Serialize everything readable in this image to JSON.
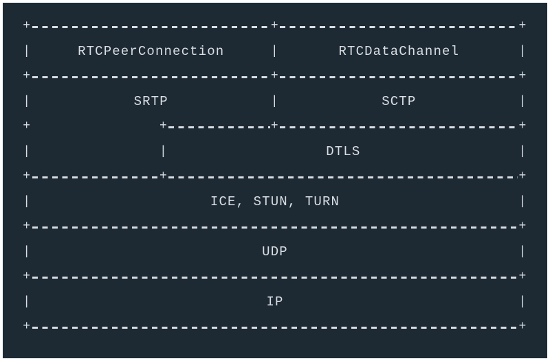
{
  "colors": {
    "background": "#1e2a33",
    "foreground": "#d8dee3"
  },
  "stack": {
    "row1": {
      "left": "RTCPeerConnection",
      "right": "RTCDataChannel"
    },
    "row2": {
      "left": "SRTP",
      "right": "SCTP"
    },
    "row3": {
      "right": "DTLS"
    },
    "row4": "ICE, STUN, TURN",
    "row5": "UDP",
    "row6": "IP"
  },
  "glyphs": {
    "plus": "+",
    "bar": "|"
  }
}
